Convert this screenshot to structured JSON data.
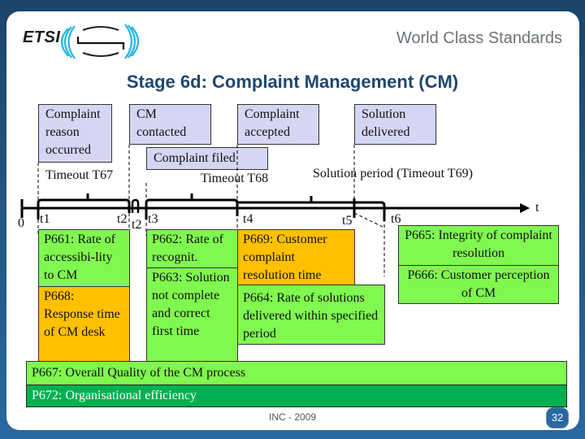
{
  "header": {
    "logo_text": "ETSI",
    "tagline": "World Class Standards",
    "title": "Stage 6d: Complaint Management (CM)"
  },
  "events": [
    {
      "id": "complaint-reason-occurred",
      "label": "Complaint reason occurred"
    },
    {
      "id": "cm-contacted",
      "label": "CM contacted"
    },
    {
      "id": "complaint-accepted",
      "label": "Complaint accepted"
    },
    {
      "id": "solution-delivered",
      "label": "Solution delivered"
    },
    {
      "id": "complaint-filed",
      "label": "Complaint filed"
    }
  ],
  "timeouts": [
    {
      "id": "t67",
      "label": "Timeout T67"
    },
    {
      "id": "t68",
      "label": "Timeout T68"
    },
    {
      "id": "t69",
      "label": "Solution period (Timeout T69)"
    }
  ],
  "axis": {
    "origin": "0",
    "end_label": "t",
    "ticks": [
      "t1",
      "t2",
      "t2",
      "t3",
      "t4",
      "t5",
      "t6"
    ]
  },
  "parameters": [
    {
      "id": "P661",
      "label": "P661: Rate of accessibi-lity to CM",
      "color": "#80f850"
    },
    {
      "id": "P668",
      "label": "P668: Response time of CM desk",
      "color": "#ffc000"
    },
    {
      "id": "P662",
      "label": "P662: Rate of recognit.",
      "color": "#80f850"
    },
    {
      "id": "P663",
      "label": "P663: Solution not complete and correct first time",
      "color": "#80f850"
    },
    {
      "id": "P669",
      "label": "P669: Customer complaint resolution time",
      "color": "#ffc000"
    },
    {
      "id": "P664",
      "label": "P664: Rate of solutions delivered within specified period",
      "color": "#80f850"
    },
    {
      "id": "P665",
      "label": "P665: Integrity of complaint resolution",
      "color": "#80f850"
    },
    {
      "id": "P666",
      "label": "P666: Customer perception of CM",
      "color": "#80f850"
    },
    {
      "id": "P667",
      "label": "P667: Overall Quality of the CM process",
      "color": "#80f850"
    },
    {
      "id": "P672",
      "label": "P672: Organisational efficiency",
      "color": "#00b050"
    }
  ],
  "footer": {
    "text": "INC - 2009",
    "page_number": "32"
  }
}
